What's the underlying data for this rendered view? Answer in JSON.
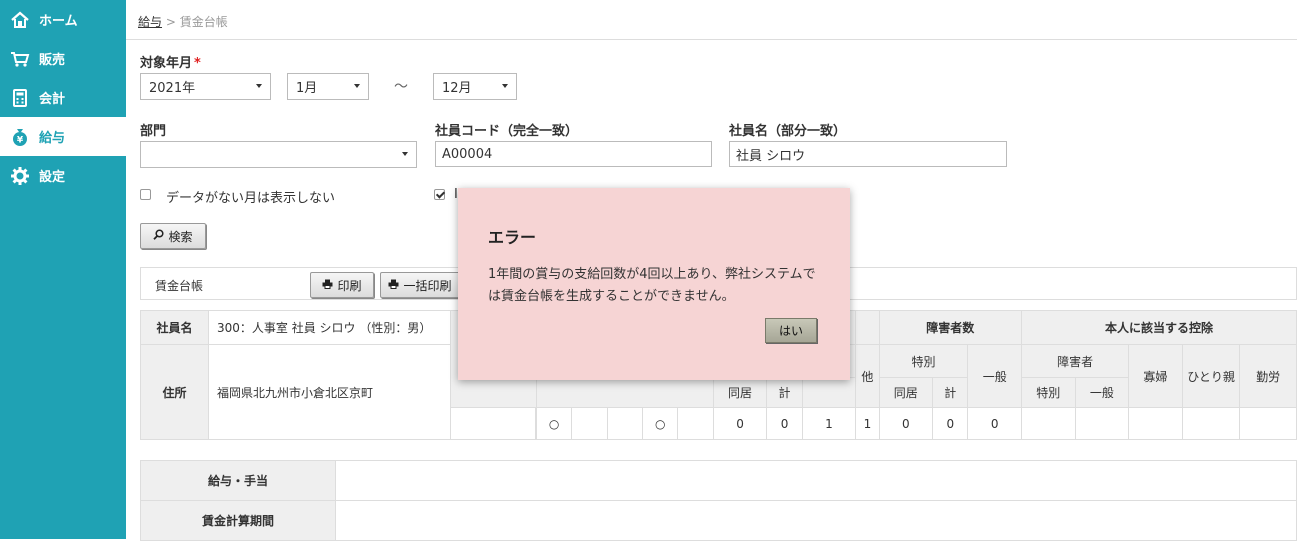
{
  "sidebar": {
    "items": [
      {
        "label": "ホーム",
        "icon": "home-icon"
      },
      {
        "label": "販売",
        "icon": "cart-icon"
      },
      {
        "label": "会計",
        "icon": "calculator-icon"
      },
      {
        "label": "給与",
        "icon": "money-bag-icon"
      },
      {
        "label": "設定",
        "icon": "gear-icon"
      }
    ],
    "active_color": "#1fa2b4"
  },
  "breadcrumb": {
    "parent": "給与",
    "sep": ">",
    "current": "賃金台帳"
  },
  "filters": {
    "period_label": "対象年月",
    "required_mark": "*",
    "year": "2021年",
    "month_from": "1月",
    "tilde": "〜",
    "month_to": "12月",
    "dept_label": "部門",
    "dept_value": "",
    "code_label": "社員コード（完全一致）",
    "code_value": "A00004",
    "name_label": "社員名（部分一致）",
    "name_value": "社員 シロウ",
    "hide_empty_label": "データがない月は表示しない",
    "check2_partial": "Ⅰ"
  },
  "buttons": {
    "search": "検索",
    "print": "印刷",
    "bulk_print": "一括印刷"
  },
  "ledger": {
    "title": "賃金台帳",
    "name_label": "社員名",
    "name_value": "300：人事室 社員 シロウ （性別：男）",
    "address_label": "住所",
    "address_value": "福岡県北九州市小倉北区京町"
  },
  "deductions": {
    "disabled_header": "障害者数",
    "self_header": "本人に該当する控除",
    "special": "特別",
    "general": "一般",
    "disabled": "障害者",
    "other": "他",
    "cohabit": "同居",
    "total": "計",
    "widow": "寡婦",
    "single_parent": "ひとり親",
    "working_student": "勤労",
    "row_values": [
      "○",
      "",
      "",
      "○",
      "",
      "0",
      "0",
      "1",
      "1",
      "0",
      "0",
      "0"
    ]
  },
  "lower": {
    "pay_label": "給与・手当",
    "period_label": "賃金計算期間"
  },
  "dialog": {
    "title": "エラー",
    "message": "1年間の賞与の支給回数が4回以上あり、弊社システムでは賃金台帳を生成することができません。",
    "ok": "はい",
    "bg_color": "#f6d4d4"
  }
}
